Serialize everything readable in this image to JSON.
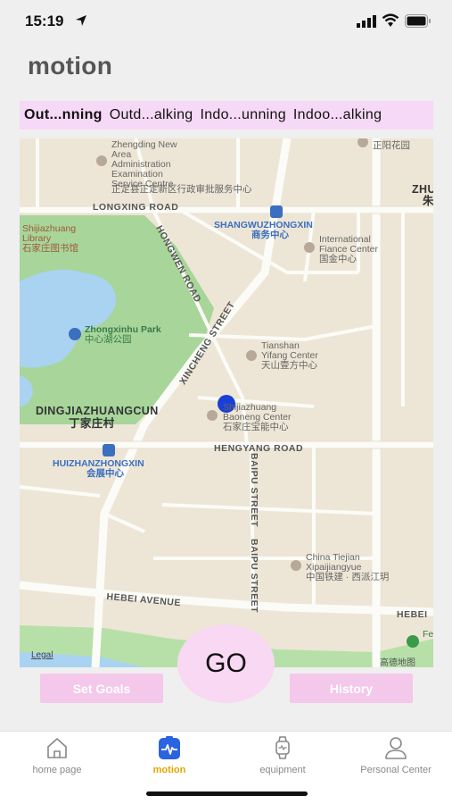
{
  "status_bar": {
    "time": "15:19"
  },
  "page_title": "motion",
  "sport_tabs": [
    {
      "label": "Out...nning",
      "active": true
    },
    {
      "label": "Outd...alking",
      "active": false
    },
    {
      "label": "Indo...unning",
      "active": false
    },
    {
      "label": "Indoo...alking",
      "active": false
    }
  ],
  "map": {
    "labels": {
      "zhengding": "Zhengding New\nArea\nAdministration\nExamination\nService Centre",
      "zhengding_cn": "正定县正定新区行政审批服务中心",
      "longxing_road": "LONGXING ROAD",
      "shangwu": "SHANGWUZHONGXIN",
      "shangwu_cn": "商务中心",
      "zhengyang": "正阳花园",
      "zhu": "ZHU",
      "zhu_cn": "朱",
      "library": "Shijiazhuang\nLibrary",
      "library_cn": "石家庄图书馆",
      "hongwen_road": "HONGWEN ROAD",
      "ifc": "International\nFiance Center",
      "ifc_cn": "国金中心",
      "park": "Zhongxinhu Park",
      "park_cn": "中心湖公园",
      "xincheng_street": "XINCHENG STREET",
      "tianshan": "Tianshan\nYifang Center",
      "tianshan_cn": "天山壹方中心",
      "dingjia": "DINGJIAZHUANGCUN",
      "dingjia_cn": "丁家庄村",
      "baoneng": "Shijiazhuang\nBaoneng Center",
      "baoneng_cn": "石家庄宝能中心",
      "hengyang_road": "HENGYANG ROAD",
      "huizhan": "HUIZHANZHONGXIN",
      "huizhan_cn": "会展中心",
      "baipu_street_1": "BAIPU STREET",
      "baipu_street_2": "BAIPU STREET",
      "tiejian": "China Tiejian\nXipaijiangyue",
      "tiejian_cn": "中国铁建 · 西派江玥",
      "hebei_avenue": "HEBEI AVENUE",
      "hebei_right": "HEBEI",
      "fe": "Fe",
      "legal": "Legal",
      "provider": "高德地图"
    }
  },
  "actions": {
    "go": "GO",
    "set_goals": "Set Goals",
    "history": "History"
  },
  "tab_bar": [
    {
      "label": "home page",
      "icon": "home-icon",
      "active": false
    },
    {
      "label": "motion",
      "icon": "motion-icon",
      "active": true
    },
    {
      "label": "equipment",
      "icon": "watch-icon",
      "active": false
    },
    {
      "label": "Personal Center",
      "icon": "person-icon",
      "active": false
    }
  ],
  "colors": {
    "accent_pink": "#f8d8f2",
    "button_pink": "#f4c8ea",
    "tab_active": "#e3a500",
    "location_dot": "#1a3fd6",
    "park_green": "#9fd28a",
    "lake_blue": "#a9d3f0"
  }
}
